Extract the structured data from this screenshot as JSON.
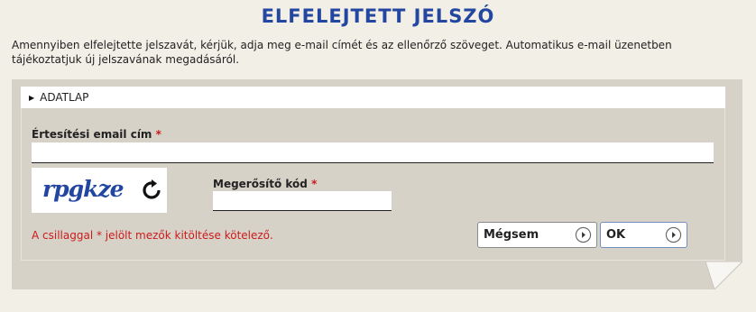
{
  "page": {
    "title": "ELFELEJTETT JELSZÓ",
    "intro": "Amennyiben elfelejtette jelszavát, kérjük, adja meg e-mail címét és az ellenőrző szöveget. Automatikus e-mail üzenetben tájékoztatjuk új jelszavának megadásáról."
  },
  "section": {
    "header": "ADATLAP",
    "caret_icon": "caret-right-icon"
  },
  "form": {
    "email_label": "Értesítési email cím",
    "email_value": "",
    "required_marker": "*",
    "captcha_text": "rpgkze",
    "refresh_icon": "refresh-icon",
    "code_label": "Megerősítő kód",
    "code_value": "",
    "required_note": "A csillaggal * jelölt mezők kitöltése kötelező."
  },
  "buttons": {
    "cancel_label": "Mégsem",
    "ok_label": "OK",
    "button_icon": "chevron-circle-right-icon"
  },
  "colors": {
    "title": "#2346a0",
    "required": "#cc1b1b",
    "panel": "#d6d2c8",
    "background": "#f2efe6"
  }
}
